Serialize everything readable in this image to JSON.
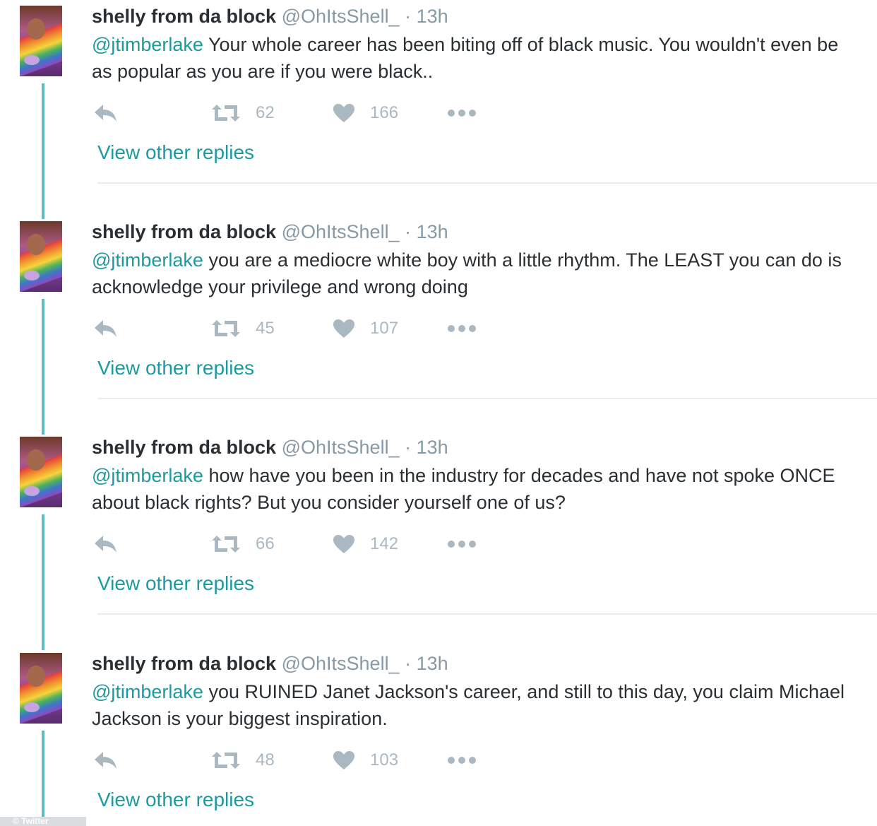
{
  "tweets": [
    {
      "name": "shelly from da block",
      "handle": "@OhItsShell_",
      "separator": " · ",
      "time": "13h",
      "mention": "@jtimberlake",
      "text": " Your whole career has been biting off of black music. You wouldn't even be as popular as you are if you were black..",
      "retweets": "62",
      "likes": "166",
      "view_replies": "View other replies"
    },
    {
      "name": "shelly from da block",
      "handle": "@OhItsShell_",
      "separator": " · ",
      "time": "13h",
      "mention": "@jtimberlake",
      "text": " you are a mediocre white boy with a little rhythm. The LEAST you can do is acknowledge your privilege and wrong doing",
      "retweets": "45",
      "likes": "107",
      "view_replies": "View other replies"
    },
    {
      "name": "shelly from da block",
      "handle": "@OhItsShell_",
      "separator": " · ",
      "time": "13h",
      "mention": "@jtimberlake",
      "text": " how have you been in the industry for decades and have not spoke ONCE about black rights? But you consider yourself one of us?",
      "retweets": "66",
      "likes": "142",
      "view_replies": "View other replies"
    },
    {
      "name": "shelly from da block",
      "handle": "@OhItsShell_",
      "separator": " · ",
      "time": "13h",
      "mention": "@jtimberlake",
      "text": " you RUINED Janet Jackson's career, and still to this day, you claim Michael Jackson is your biggest inspiration.",
      "retweets": "48",
      "likes": "103",
      "view_replies": "View other replies"
    }
  ],
  "watermark": "© Twitter",
  "colors": {
    "accent": "#1c9aa0",
    "thread_line": "#5cbcbf",
    "muted": "#8899a6",
    "icon": "#aab8c2"
  }
}
